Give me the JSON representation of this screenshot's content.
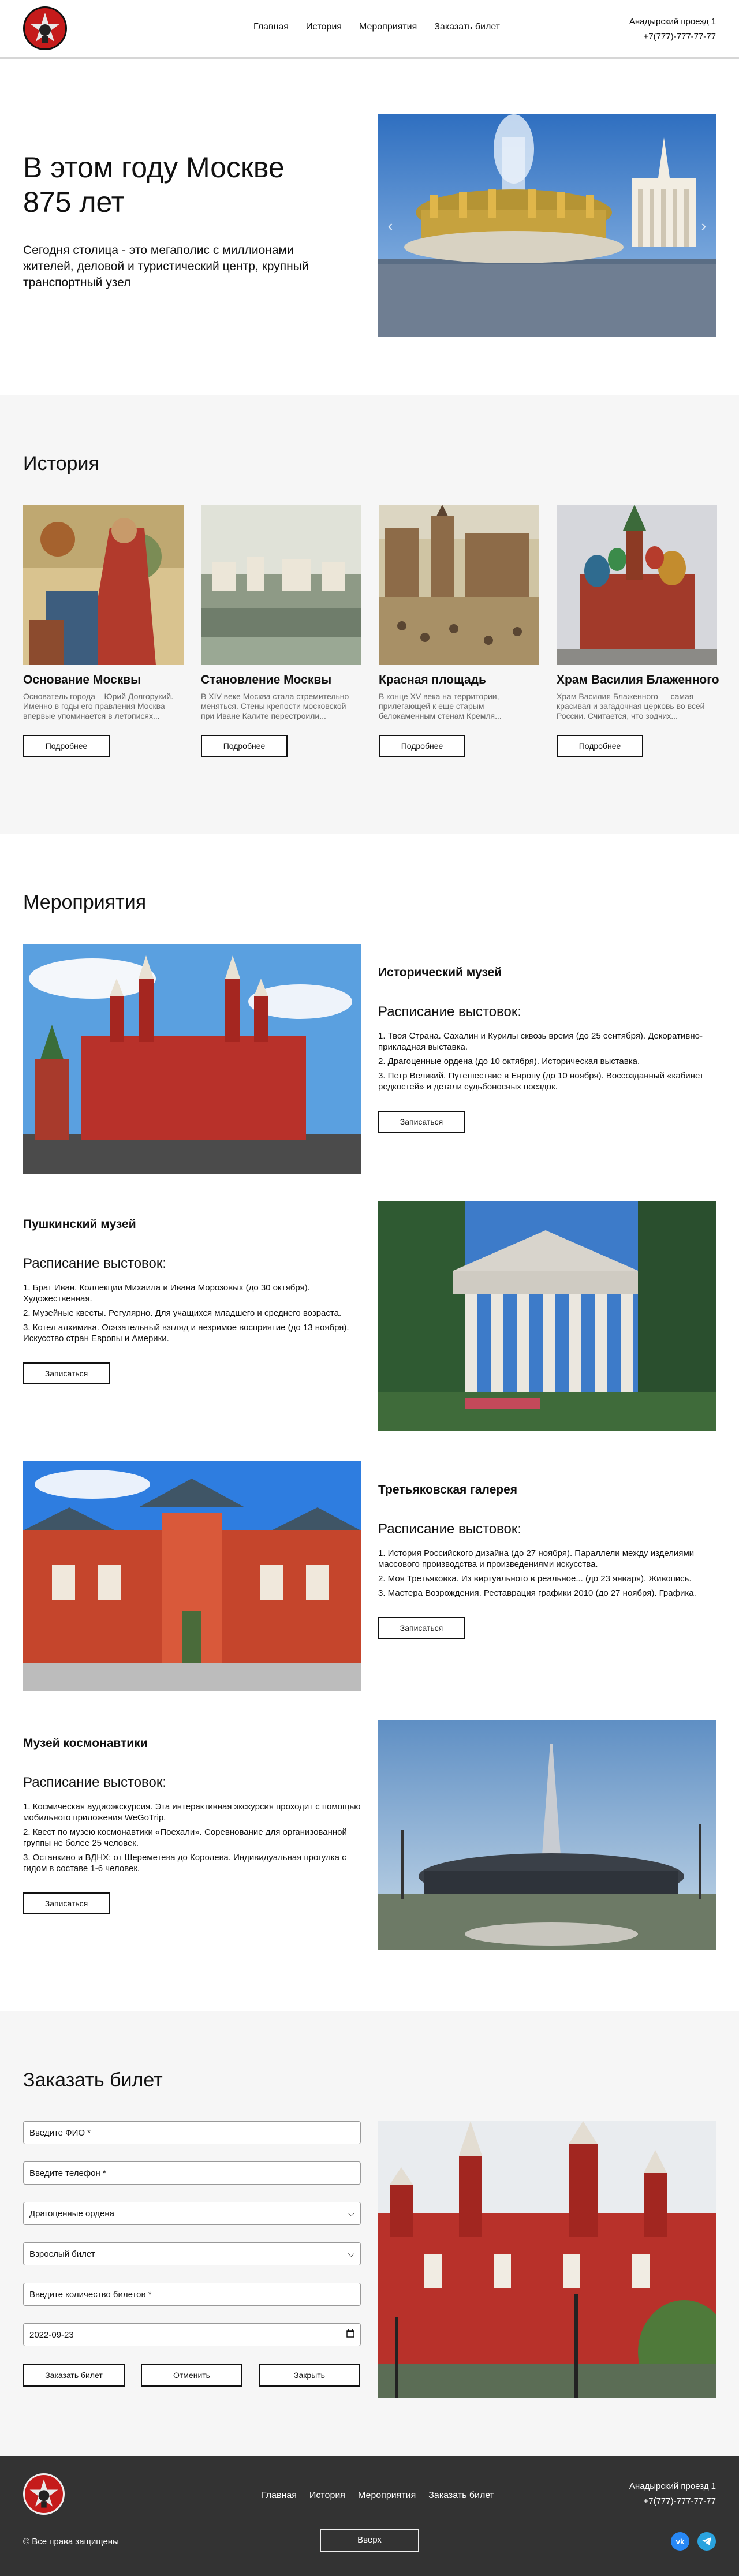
{
  "header": {
    "nav": [
      "Главная",
      "История",
      "Мероприятия",
      "Заказать билет"
    ],
    "address": "Анадырский проезд 1",
    "phone": "+7(777)-777-77-77"
  },
  "hero": {
    "title": "В этом году Москве 875 лет",
    "subtitle": "Сегодня столица - это мегаполис с миллионами жителей, деловой и туристический центр, крупный транспортный узел"
  },
  "history": {
    "title": "История",
    "cards": [
      {
        "title": "Основание Москвы",
        "text": "Основатель города – Юрий Долгорукий. Именно в годы его правления Москва впервые упоминается в летописях...",
        "button": "Подробнее"
      },
      {
        "title": "Становление Москвы",
        "text": "В XIV веке Москва стала стремительно меняться. Стены крепости московской при Иване Калите перестроили...",
        "button": "Подробнее"
      },
      {
        "title": "Красная площадь",
        "text": "В конце XV века на территории, прилегающей к еще старым белокаменным стенам Кремля...",
        "button": "Подробнее"
      },
      {
        "title": "Храм Василия Блаженного",
        "text": "Храм Василия Блаженного — самая красивая и загадочная церковь во всей России. Считается, что зодчих...",
        "button": "Подробнее"
      }
    ]
  },
  "events": {
    "title": "Мероприятия",
    "items": [
      {
        "name": "Исторический музей",
        "schedule_title": "Расписание выстовок:",
        "lines": [
          "1. Твоя Страна. Сахалин и Курилы сквозь время (до 25 сентября). Декоративно-прикладная выставка.",
          "2. Драгоценные ордена (до 10 октября). Историческая выставка.",
          "3. Петр Великий. Путешествие в Европу (до 10 ноября). Воссозданный «кабинет редкостей» и детали судьбоносных поездок."
        ],
        "button": "Записаться"
      },
      {
        "name": "Пушкинский музей",
        "schedule_title": "Расписание выстовок:",
        "lines": [
          "1. Брат Иван. Коллекции Михаила и Ивана Морозовых (до 30 октября). Художественная.",
          "2. Музейные квесты. Регулярно. Для учащихся младшего и среднего возраста.",
          "3. Котел алхимика. Осязательный взгляд и незримое восприятие (до 13 ноября). Искусство стран Европы и Америки."
        ],
        "button": "Записаться"
      },
      {
        "name": "Третьяковская галерея",
        "schedule_title": "Расписание выстовок:",
        "lines": [
          "1. История Российского дизайна (до 27 ноября). Параллели между изделиями массового производства и произведениями искусства.",
          "2. Моя Третьяковка. Из виртуального в реальное... (до 23 января). Живопись.",
          "3. Мастера Возрождения. Реставрация графики 2010 (до 27 ноября). Графика."
        ],
        "button": "Записаться"
      },
      {
        "name": "Музей космонавтики",
        "schedule_title": "Расписание выстовок:",
        "lines": [
          "1. Космическая аудиоэкскурсия. Эта интерактивная экскурсия проходит с помощью мобильного приложения WeGoTrip.",
          "2. Квест по музею космонавтики «Поехали». Соревнование для организованной группы не более 25 человек.",
          "3. Останкино и ВДНХ: от Шереметева до Королева. Индивидуальная прогулка с гидом в составе 1-6 человек."
        ],
        "button": "Записаться"
      }
    ]
  },
  "order": {
    "title": "Заказать билет",
    "name_placeholder": "Введите ФИО *",
    "phone_placeholder": "Введите телефон *",
    "event_select": "Драгоценные ордена",
    "ticket_select": "Взрослый билет",
    "count_placeholder": "Введите количество билетов *",
    "date_value": "2022-09-23",
    "buttons": [
      "Заказать билет",
      "Отменить",
      "Закрыть"
    ]
  },
  "footer": {
    "nav": [
      "Главная",
      "История",
      "Мероприятия",
      "Заказать билет"
    ],
    "address": "Анадырский проезд 1",
    "phone": "+7(777)-777-77-77",
    "copyright": "© Все права защищены",
    "up_button": "Вверх",
    "vk_label": "vk",
    "colors": {
      "accent": "#c51b1b",
      "vk": "#2787f5",
      "telegram": "#2aa3df",
      "footer_bg": "#333333"
    }
  }
}
